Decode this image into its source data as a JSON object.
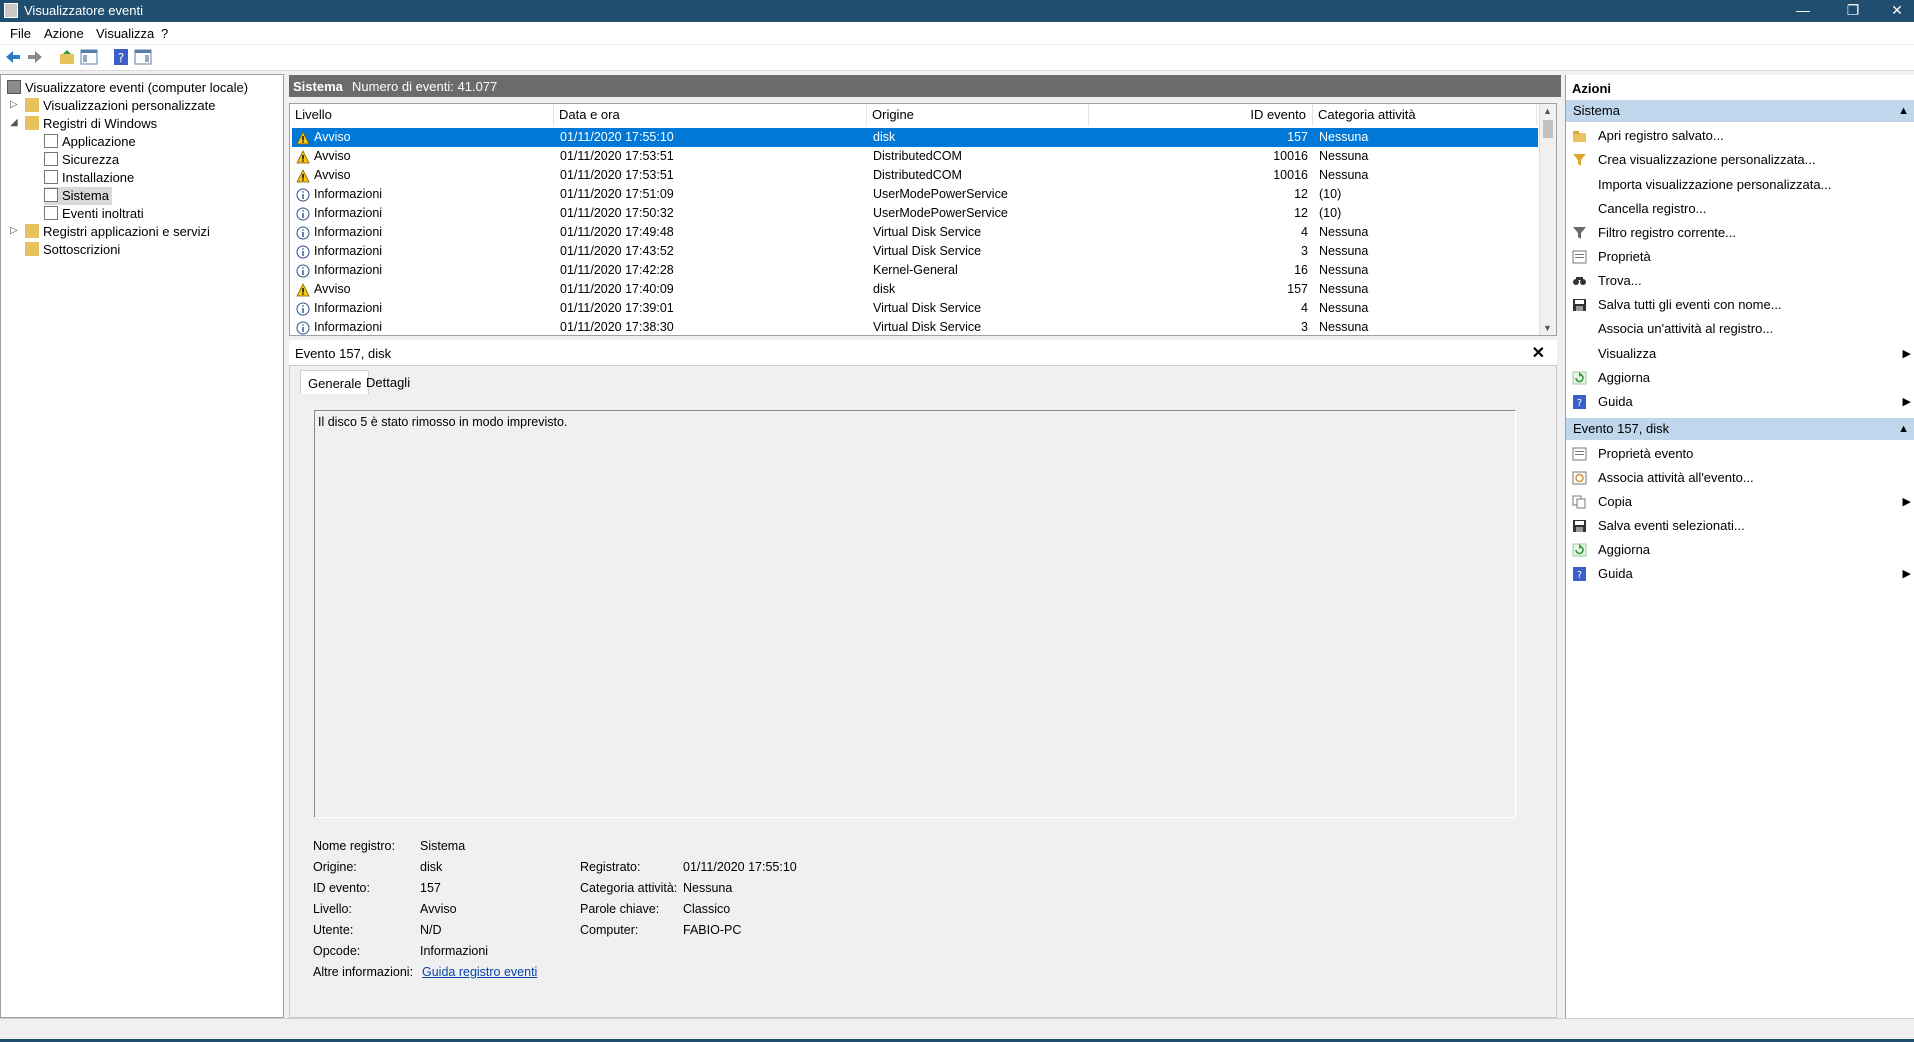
{
  "window": {
    "title": "Visualizzatore eventi",
    "controls": {
      "minimize": "—",
      "maximize": "❐",
      "close": "✕"
    }
  },
  "menu": [
    "File",
    "Azione",
    "Visualizza",
    "?"
  ],
  "toolbar": [
    "back-icon",
    "forward-icon",
    "folder-up-icon",
    "show-hide-tree-icon",
    "help-icon",
    "show-hide-actions-icon"
  ],
  "tree": {
    "root": "Visualizzatore eventi (computer locale)",
    "custom_views": "Visualizzazioni personalizzate",
    "windows_logs": "Registri di Windows",
    "logs": [
      "Applicazione",
      "Sicurezza",
      "Installazione",
      "Sistema",
      "Eventi inoltrati"
    ],
    "app_services": "Registri applicazioni e servizi",
    "subscriptions": "Sottoscrizioni"
  },
  "list_header": {
    "log": "Sistema",
    "count": "Numero di eventi: 41.077"
  },
  "columns": [
    "Livello",
    "Data e ora",
    "Origine",
    "ID evento",
    "Categoria attività"
  ],
  "events": [
    {
      "level": "Avviso",
      "type": "warning",
      "datetime": "01/11/2020 17:55:10",
      "source": "disk",
      "id": "157",
      "category": "Nessuna"
    },
    {
      "level": "Avviso",
      "type": "warning",
      "datetime": "01/11/2020 17:53:51",
      "source": "DistributedCOM",
      "id": "10016",
      "category": "Nessuna"
    },
    {
      "level": "Avviso",
      "type": "warning",
      "datetime": "01/11/2020 17:53:51",
      "source": "DistributedCOM",
      "id": "10016",
      "category": "Nessuna"
    },
    {
      "level": "Informazioni",
      "type": "info",
      "datetime": "01/11/2020 17:51:09",
      "source": "UserModePowerService",
      "id": "12",
      "category": "(10)"
    },
    {
      "level": "Informazioni",
      "type": "info",
      "datetime": "01/11/2020 17:50:32",
      "source": "UserModePowerService",
      "id": "12",
      "category": "(10)"
    },
    {
      "level": "Informazioni",
      "type": "info",
      "datetime": "01/11/2020 17:49:48",
      "source": "Virtual Disk Service",
      "id": "4",
      "category": "Nessuna"
    },
    {
      "level": "Informazioni",
      "type": "info",
      "datetime": "01/11/2020 17:43:52",
      "source": "Virtual Disk Service",
      "id": "3",
      "category": "Nessuna"
    },
    {
      "level": "Informazioni",
      "type": "info",
      "datetime": "01/11/2020 17:42:28",
      "source": "Kernel-General",
      "id": "16",
      "category": "Nessuna"
    },
    {
      "level": "Avviso",
      "type": "warning",
      "datetime": "01/11/2020 17:40:09",
      "source": "disk",
      "id": "157",
      "category": "Nessuna"
    },
    {
      "level": "Informazioni",
      "type": "info",
      "datetime": "01/11/2020 17:39:01",
      "source": "Virtual Disk Service",
      "id": "4",
      "category": "Nessuna"
    },
    {
      "level": "Informazioni",
      "type": "info",
      "datetime": "01/11/2020 17:38:30",
      "source": "Virtual Disk Service",
      "id": "3",
      "category": "Nessuna"
    }
  ],
  "detail": {
    "title": "Evento 157, disk",
    "close": "✕",
    "tabs": [
      "Generale",
      "Dettagli"
    ],
    "description": "Il disco 5 è stato rimosso in modo imprevisto.",
    "fields": {
      "log_name_label": "Nome registro:",
      "log_name": "Sistema",
      "source_label": "Origine:",
      "source": "disk",
      "logged_label": "Registrato:",
      "logged": "01/11/2020 17:55:10",
      "event_id_label": "ID evento:",
      "event_id": "157",
      "task_label": "Categoria attività:",
      "task": "Nessuna",
      "level_label": "Livello:",
      "level": "Avviso",
      "keywords_label": "Parole chiave:",
      "keywords": "Classico",
      "user_label": "Utente:",
      "user": "N/D",
      "computer_label": "Computer:",
      "computer": "FABIO-PC",
      "opcode_label": "Opcode:",
      "opcode": "Informazioni",
      "more_info_label": "Altre informazioni:",
      "more_info_link": "Guida registro eventi"
    }
  },
  "actions": {
    "title": "Azioni",
    "section1": "Sistema",
    "items1": [
      {
        "label": "Apri registro salvato...",
        "icon": "open-folder-icon"
      },
      {
        "label": "Crea visualizzazione personalizzata...",
        "icon": "filter-create-icon"
      },
      {
        "label": "Importa visualizzazione personalizzata...",
        "icon": ""
      },
      {
        "label": "Cancella registro...",
        "icon": ""
      },
      {
        "label": "Filtro registro corrente...",
        "icon": "filter-icon"
      },
      {
        "label": "Proprietà",
        "icon": "properties-icon"
      },
      {
        "label": "Trova...",
        "icon": "find-icon"
      },
      {
        "label": "Salva tutti gli eventi con nome...",
        "icon": "save-icon"
      },
      {
        "label": "Associa un'attività al registro...",
        "icon": ""
      },
      {
        "label": "Visualizza",
        "icon": "",
        "submenu": true
      },
      {
        "label": "Aggiorna",
        "icon": "refresh-icon"
      },
      {
        "label": "Guida",
        "icon": "help-icon",
        "submenu": true
      }
    ],
    "section2": "Evento 157, disk",
    "items2": [
      {
        "label": "Proprietà evento",
        "icon": "properties-icon"
      },
      {
        "label": "Associa attività all'evento...",
        "icon": "task-icon"
      },
      {
        "label": "Copia",
        "icon": "copy-icon",
        "submenu": true
      },
      {
        "label": "Salva eventi selezionati...",
        "icon": "save-icon"
      },
      {
        "label": "Aggiorna",
        "icon": "refresh-icon"
      },
      {
        "label": "Guida",
        "icon": "help-icon",
        "submenu": true
      }
    ]
  }
}
